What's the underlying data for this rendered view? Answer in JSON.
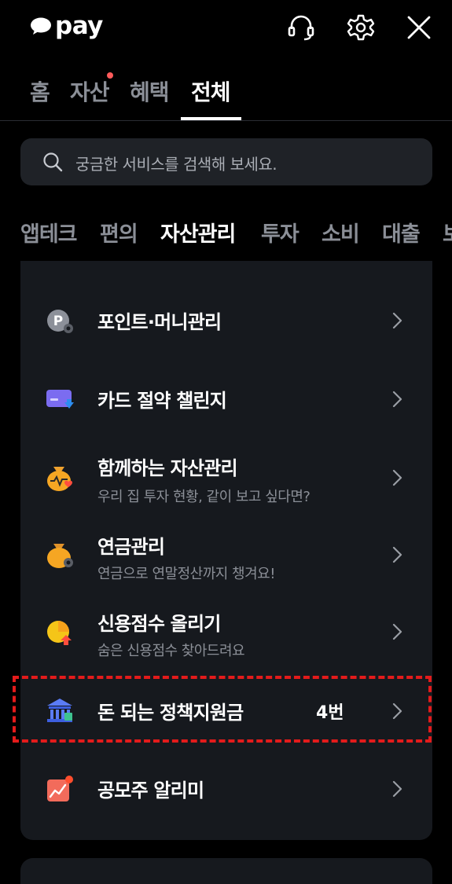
{
  "header": {
    "logo_text": "pay",
    "icons": [
      "headset-icon",
      "gear-icon",
      "close-icon"
    ]
  },
  "main_tabs": [
    {
      "label": "홈"
    },
    {
      "label": "자산",
      "has_dot": true
    },
    {
      "label": "혜택"
    },
    {
      "label": "전체",
      "active": true
    }
  ],
  "search": {
    "placeholder": "궁금한 서비스를 검색해 보세요."
  },
  "category_tabs": [
    {
      "label": "앱테크"
    },
    {
      "label": "편의"
    },
    {
      "label": "자산관리",
      "active": true
    },
    {
      "label": "투자"
    },
    {
      "label": "소비"
    },
    {
      "label": "대출"
    },
    {
      "label": "보"
    }
  ],
  "services": [
    {
      "title": "포인트·머니관리",
      "subtitle": "",
      "icon": "point-money-icon"
    },
    {
      "title": "카드 절약 챌린지",
      "subtitle": "",
      "icon": "card-challenge-icon"
    },
    {
      "title": "함께하는 자산관리",
      "subtitle": "우리 집 투자 현황, 같이 보고 싶다면?",
      "icon": "shared-assets-icon"
    },
    {
      "title": "연금관리",
      "subtitle": "연금으로 연말정산까지 챙겨요!",
      "icon": "pension-icon"
    },
    {
      "title": "신용점수 올리기",
      "subtitle": "숨은 신용점수 찾아드려요",
      "icon": "credit-score-icon"
    },
    {
      "title": "돈 되는 정책지원금",
      "subtitle": "",
      "icon": "bank-icon",
      "annotation": "4번",
      "highlighted": true
    },
    {
      "title": "공모주 알리미",
      "subtitle": "",
      "icon": "ipo-alert-icon"
    }
  ],
  "colors": {
    "background": "#000000",
    "card": "#16191e",
    "search_bg": "#1f2227",
    "inactive_text": "#8b8f97",
    "dot_red": "#ff5a5a",
    "highlight_red": "#e31b1b"
  }
}
